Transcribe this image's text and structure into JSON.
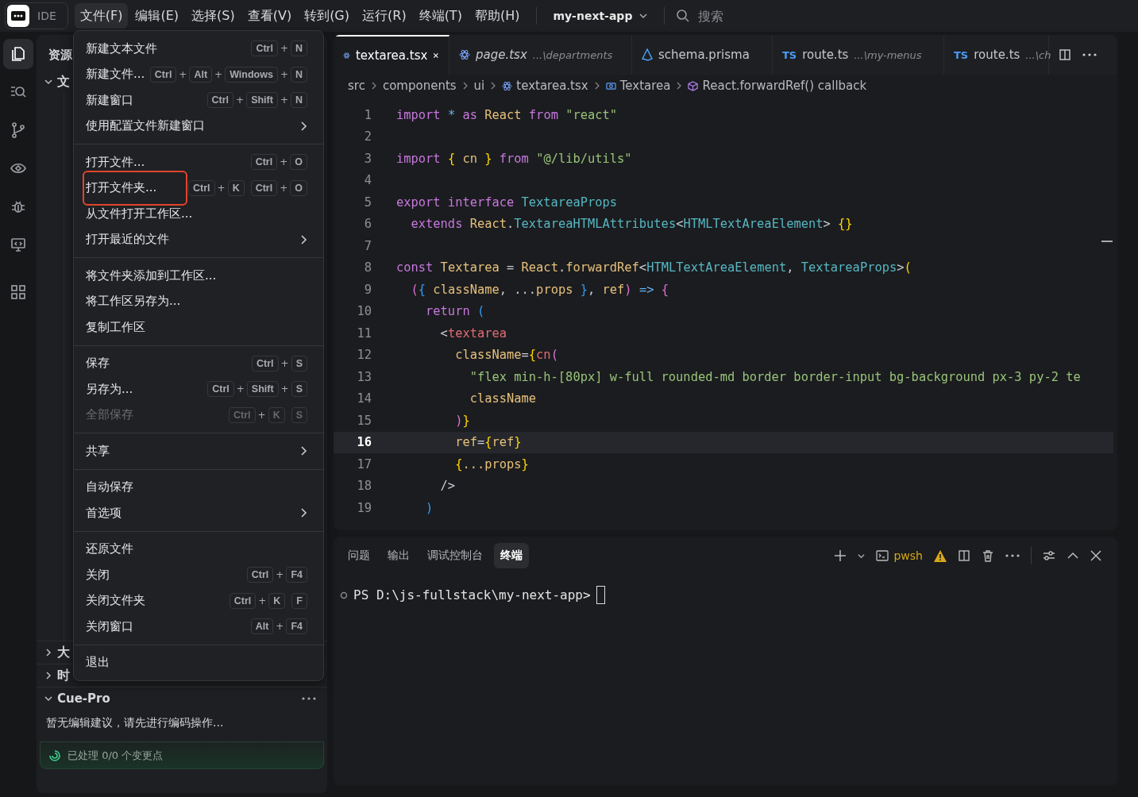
{
  "titlebar": {
    "app_label": "IDE",
    "menus": [
      {
        "label": "文件(F)",
        "selected": true
      },
      {
        "label": "编辑(E)",
        "selected": false
      },
      {
        "label": "选择(S)",
        "selected": false
      },
      {
        "label": "查看(V)",
        "selected": false
      },
      {
        "label": "转到(G)",
        "selected": false
      },
      {
        "label": "运行(R)",
        "selected": false
      },
      {
        "label": "终端(T)",
        "selected": false
      },
      {
        "label": "帮助(H)",
        "selected": false
      }
    ],
    "project": "my-next-app",
    "search": {
      "placeholder": "搜索"
    }
  },
  "activity_bar": [
    {
      "kind": "files",
      "selected": true
    },
    {
      "kind": "search",
      "selected": false
    },
    {
      "kind": "branch",
      "selected": false
    },
    {
      "kind": "eye",
      "selected": false
    },
    {
      "kind": "bug",
      "selected": false
    },
    {
      "kind": "monitor",
      "selected": false
    },
    {
      "kind": "grid",
      "selected": false
    }
  ],
  "sidebar": {
    "title": "资源",
    "sections": [
      {
        "label": "文",
        "expanded": true
      }
    ],
    "bottom_sections": [
      {
        "label": "大",
        "expanded": false
      },
      {
        "label": "时",
        "expanded": false
      }
    ],
    "cue_pro": {
      "title": "Cue-Pro",
      "expanded": true,
      "message": "暂无编辑建议，请先进行编码操作...",
      "status": "已处理 0/0 个变更点"
    }
  },
  "file_menu": {
    "groups": [
      [
        {
          "label": "新建文本文件",
          "shortcut": [
            [
              "Ctrl",
              "+",
              "N"
            ]
          ],
          "submenu": false,
          "disabled": false,
          "highlighted": false
        },
        {
          "label": "新建文件...",
          "shortcut": [
            [
              "Ctrl",
              "+",
              "Alt",
              "+",
              "Windows",
              "+",
              "N"
            ]
          ],
          "submenu": false,
          "disabled": false,
          "highlighted": false
        },
        {
          "label": "新建窗口",
          "shortcut": [
            [
              "Ctrl",
              "+",
              "Shift",
              "+",
              "N"
            ]
          ],
          "submenu": false,
          "disabled": false,
          "highlighted": false
        },
        {
          "label": "使用配置文件新建窗口",
          "submenu": true,
          "disabled": false,
          "highlighted": false
        }
      ],
      [
        {
          "label": "打开文件...",
          "shortcut": [
            [
              "Ctrl",
              "+",
              "O"
            ]
          ],
          "submenu": false,
          "disabled": false,
          "highlighted": false
        },
        {
          "label": "打开文件夹...",
          "shortcut": [
            [
              "Ctrl",
              "+",
              "K"
            ],
            [
              "Ctrl",
              "+",
              "O"
            ]
          ],
          "submenu": false,
          "disabled": false,
          "highlighted": true
        },
        {
          "label": "从文件打开工作区...",
          "submenu": false,
          "disabled": false,
          "highlighted": false
        },
        {
          "label": "打开最近的文件",
          "submenu": true,
          "disabled": false,
          "highlighted": false
        }
      ],
      [
        {
          "label": "将文件夹添加到工作区...",
          "submenu": false,
          "disabled": false,
          "highlighted": false
        },
        {
          "label": "将工作区另存为...",
          "submenu": false,
          "disabled": false,
          "highlighted": false
        },
        {
          "label": "复制工作区",
          "submenu": false,
          "disabled": false,
          "highlighted": false
        }
      ],
      [
        {
          "label": "保存",
          "shortcut": [
            [
              "Ctrl",
              "+",
              "S"
            ]
          ],
          "submenu": false,
          "disabled": false,
          "highlighted": false
        },
        {
          "label": "另存为...",
          "shortcut": [
            [
              "Ctrl",
              "+",
              "Shift",
              "+",
              "S"
            ]
          ],
          "submenu": false,
          "disabled": false,
          "highlighted": false
        },
        {
          "label": "全部保存",
          "shortcut": [
            [
              "Ctrl",
              "+",
              "K"
            ],
            [
              "S"
            ]
          ],
          "submenu": false,
          "disabled": true,
          "highlighted": false
        }
      ],
      [
        {
          "label": "共享",
          "submenu": true,
          "disabled": false,
          "highlighted": false
        }
      ],
      [
        {
          "label": "自动保存",
          "submenu": false,
          "disabled": false,
          "highlighted": false
        },
        {
          "label": "首选项",
          "submenu": true,
          "disabled": false,
          "highlighted": false
        }
      ],
      [
        {
          "label": "还原文件",
          "submenu": false,
          "disabled": false,
          "highlighted": false
        },
        {
          "label": "关闭",
          "shortcut": [
            [
              "Ctrl",
              "+",
              "F4"
            ]
          ],
          "submenu": false,
          "disabled": false,
          "highlighted": false
        },
        {
          "label": "关闭文件夹",
          "shortcut": [
            [
              "Ctrl",
              "+",
              "K"
            ],
            [
              "F"
            ]
          ],
          "submenu": false,
          "disabled": false,
          "highlighted": false
        },
        {
          "label": "关闭窗口",
          "shortcut": [
            [
              "Alt",
              "+",
              "F4"
            ]
          ],
          "submenu": false,
          "disabled": false,
          "highlighted": false
        }
      ],
      [
        {
          "label": "退出",
          "submenu": false,
          "disabled": false,
          "highlighted": false
        }
      ]
    ]
  },
  "editor": {
    "tabs": [
      {
        "kind": "react",
        "name": "textarea.tsx",
        "selected": true,
        "preview": false
      },
      {
        "kind": "react",
        "name": "page.tsx",
        "path": "...\\departments",
        "selected": false,
        "preview": true
      },
      {
        "kind": "prisma",
        "name": "schema.prisma",
        "selected": false,
        "preview": false
      },
      {
        "kind": "ts",
        "badge": "TS",
        "name": "route.ts",
        "path": "...\\my-menus",
        "selected": false,
        "preview": false
      },
      {
        "kind": "ts",
        "badge": "TS",
        "name": "route.ts",
        "path": "...\\ch",
        "selected": false,
        "preview": false
      }
    ],
    "breadcrumb": [
      {
        "kind": "folder",
        "label": "src"
      },
      {
        "kind": "folder",
        "label": "components"
      },
      {
        "kind": "folder",
        "label": "ui"
      },
      {
        "kind": "react",
        "label": "textarea.tsx"
      },
      {
        "kind": "component",
        "label": "Textarea"
      },
      {
        "kind": "method",
        "label": "React.forwardRef() callback"
      }
    ],
    "lines": [
      {
        "number": "1",
        "current": false,
        "tokens": [
          {
            "kind": "kw",
            "text": "import "
          },
          {
            "kind": "op",
            "text": "* "
          },
          {
            "kind": "kw",
            "text": "as "
          },
          {
            "kind": "cls",
            "text": "React "
          },
          {
            "kind": "kw",
            "text": "from "
          },
          {
            "kind": "str",
            "text": "\"react\""
          }
        ]
      },
      {
        "number": "2",
        "current": false
      },
      {
        "number": "3",
        "current": false,
        "tokens": [
          {
            "kind": "kw",
            "text": "import "
          },
          {
            "kind": "b1",
            "text": "{ "
          },
          {
            "kind": "cls",
            "text": "cn "
          },
          {
            "kind": "b1",
            "text": "} "
          },
          {
            "kind": "kw",
            "text": "from "
          },
          {
            "kind": "str",
            "text": "\"@/lib/utils\""
          }
        ]
      },
      {
        "number": "4",
        "current": false
      },
      {
        "number": "5",
        "current": false,
        "tokens": [
          {
            "kind": "kw",
            "text": "export interface "
          },
          {
            "kind": "type",
            "text": "TextareaProps"
          }
        ]
      },
      {
        "number": "6",
        "current": false,
        "tokens": [
          {
            "kind": "kw",
            "text": "  extends "
          },
          {
            "kind": "cls",
            "text": "React"
          },
          {
            "kind": "pl",
            "text": "."
          },
          {
            "kind": "type",
            "text": "TextareaHTMLAttributes"
          },
          {
            "kind": "pl",
            "text": "<"
          },
          {
            "kind": "type",
            "text": "HTMLTextAreaElement"
          },
          {
            "kind": "pl",
            "text": "> "
          },
          {
            "kind": "b1",
            "text": "{}"
          }
        ]
      },
      {
        "number": "7",
        "current": false
      },
      {
        "number": "8",
        "current": false,
        "tokens": [
          {
            "kind": "kw",
            "text": "const "
          },
          {
            "kind": "cls",
            "text": "Textarea "
          },
          {
            "kind": "pl",
            "text": "= "
          },
          {
            "kind": "cls",
            "text": "React"
          },
          {
            "kind": "pl",
            "text": "."
          },
          {
            "kind": "cls",
            "text": "forwardRef"
          },
          {
            "kind": "pl",
            "text": "<"
          },
          {
            "kind": "type",
            "text": "HTMLTextAreaElement"
          },
          {
            "kind": "pl",
            "text": ", "
          },
          {
            "kind": "type",
            "text": "TextareaProps"
          },
          {
            "kind": "pl",
            "text": ">"
          },
          {
            "kind": "b1",
            "text": "("
          }
        ]
      },
      {
        "number": "9",
        "current": false,
        "tokens": [
          {
            "kind": "b2",
            "text": "  ("
          },
          {
            "kind": "b3",
            "text": "{ "
          },
          {
            "kind": "cls",
            "text": "className"
          },
          {
            "kind": "pl",
            "text": ", ..."
          },
          {
            "kind": "cls",
            "text": "props "
          },
          {
            "kind": "b3",
            "text": "}"
          },
          {
            "kind": "pl",
            "text": ", "
          },
          {
            "kind": "cls",
            "text": "ref"
          },
          {
            "kind": "b2",
            "text": ")"
          },
          {
            "kind": "op",
            "text": " => "
          },
          {
            "kind": "b2",
            "text": "{"
          }
        ]
      },
      {
        "number": "10",
        "current": false,
        "tokens": [
          {
            "kind": "kw",
            "text": "    return "
          },
          {
            "kind": "b3",
            "text": "("
          }
        ]
      },
      {
        "number": "11",
        "current": false,
        "tokens": [
          {
            "kind": "pl",
            "text": "      <"
          },
          {
            "kind": "tag",
            "text": "textarea"
          }
        ]
      },
      {
        "number": "12",
        "current": false,
        "tokens": [
          {
            "kind": "cls",
            "text": "        className"
          },
          {
            "kind": "pl",
            "text": "="
          },
          {
            "kind": "b1",
            "text": "{"
          },
          {
            "kind": "tag",
            "text": "cn"
          },
          {
            "kind": "b2",
            "text": "("
          }
        ]
      },
      {
        "number": "13",
        "current": false,
        "tokens": [
          {
            "kind": "str",
            "text": "          \"flex min-h-[80px] w-full rounded-md border border-input bg-background px-3 py-2 te"
          }
        ]
      },
      {
        "number": "14",
        "current": false,
        "tokens": [
          {
            "kind": "cls",
            "text": "          className"
          }
        ]
      },
      {
        "number": "15",
        "current": false,
        "tokens": [
          {
            "kind": "b2",
            "text": "        )"
          },
          {
            "kind": "b1",
            "text": "}"
          }
        ]
      },
      {
        "number": "16",
        "current": true,
        "tokens": [
          {
            "kind": "cls",
            "text": "        ref"
          },
          {
            "kind": "pl",
            "text": "="
          },
          {
            "kind": "b1",
            "text": "{"
          },
          {
            "kind": "cls",
            "text": "ref"
          },
          {
            "kind": "b1",
            "text": "}"
          }
        ]
      },
      {
        "number": "17",
        "current": false,
        "tokens": [
          {
            "kind": "b1",
            "text": "        {"
          },
          {
            "kind": "cls",
            "text": "...props"
          },
          {
            "kind": "b1",
            "text": "}"
          }
        ]
      },
      {
        "number": "18",
        "current": false,
        "tokens": [
          {
            "kind": "pl",
            "text": "      />"
          }
        ]
      },
      {
        "number": "19",
        "current": false,
        "tokens": [
          {
            "kind": "b3",
            "text": "    )"
          }
        ]
      }
    ]
  },
  "panel": {
    "tabs": [
      {
        "label": "问题",
        "selected": false
      },
      {
        "label": "输出",
        "selected": false
      },
      {
        "label": "调试控制台",
        "selected": false
      },
      {
        "label": "终端",
        "selected": true
      }
    ],
    "shell": "pwsh",
    "terminal_prompt": "PS D:\\js-fullstack\\my-next-app>"
  }
}
